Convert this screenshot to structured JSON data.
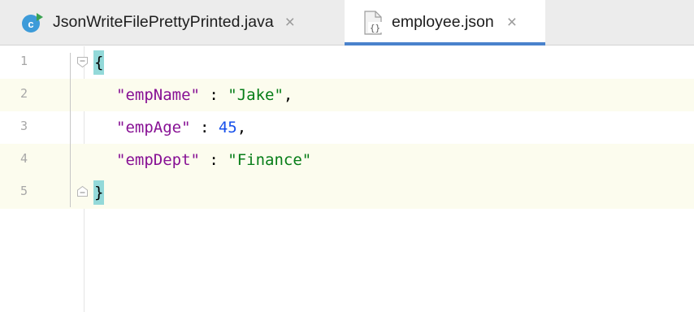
{
  "tabs": [
    {
      "label": "JsonWriteFilePrettyPrinted.java",
      "icon": "java-class-icon",
      "active": false
    },
    {
      "label": "employee.json",
      "icon": "json-file-icon",
      "active": true
    }
  ],
  "close_glyph": "×",
  "colors": {
    "key": "#871094",
    "string": "#067d17",
    "number": "#1750eb",
    "brace_highlight": "#93d9d9",
    "active_tab_underline": "#4a82cc"
  },
  "editor": {
    "line_numbers": [
      "1",
      "2",
      "3",
      "4",
      "5"
    ],
    "open_brace": "{",
    "close_brace": "}",
    "lines": [
      {
        "key": "\"empName\"",
        "sep": " : ",
        "value": "\"Jake\"",
        "trail": ","
      },
      {
        "key": "\"empAge\"",
        "sep": " : ",
        "value": "45",
        "trail": ","
      },
      {
        "key": "\"empDept\"",
        "sep": " : ",
        "value": "\"Finance\"",
        "trail": ""
      }
    ]
  }
}
